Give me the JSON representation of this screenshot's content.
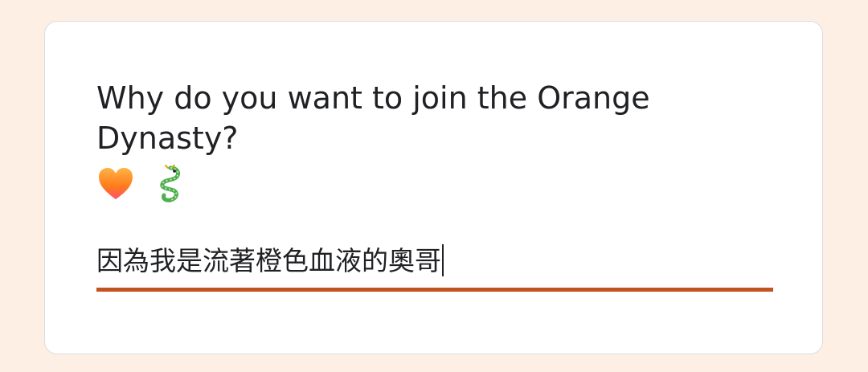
{
  "question": {
    "text": "Why do you want to join the Orange Dynasty?",
    "emojis": [
      "orange-heart-icon",
      "dragon-icon"
    ]
  },
  "answer": {
    "value": "因為我是流著橙色血液的奧哥"
  },
  "colors": {
    "page_background": "#fdefe4",
    "card_background": "#ffffff",
    "accent_underline": "#c1531f",
    "text": "#202124"
  }
}
